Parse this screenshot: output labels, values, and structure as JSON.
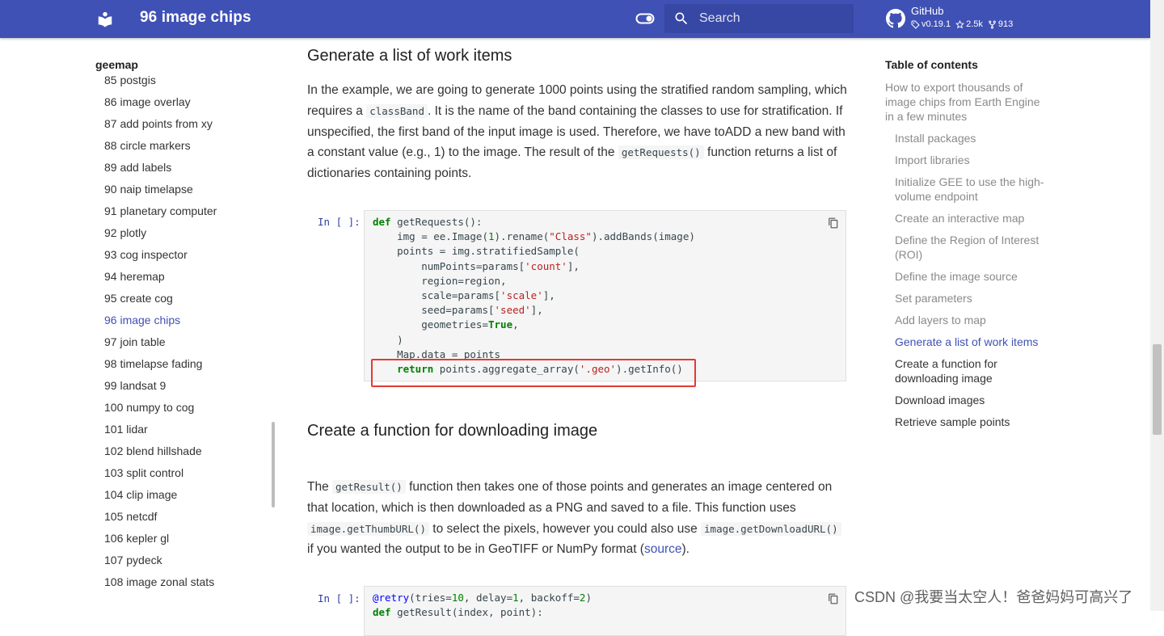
{
  "header": {
    "site_title": "96 image chips",
    "search_placeholder": "Search",
    "repo_name": "GitHub",
    "repo_version": "v0.19.1",
    "repo_stars": "2.5k",
    "repo_forks": "913",
    "colors": {
      "bar": "#4051b5",
      "search_bg": "#3647a4"
    }
  },
  "nav": {
    "title": "geemap",
    "items": [
      "85 postgis",
      "86 image overlay",
      "87 add points from xy",
      "88 circle markers",
      "89 add labels",
      "90 naip timelapse",
      "91 planetary computer",
      "92 plotly",
      "93 cog inspector",
      "94 heremap",
      "95 create cog",
      "96 image chips",
      "97 join table",
      "98 timelapse fading",
      "99 landsat 9",
      "100 numpy to cog",
      "101 lidar",
      "102 blend hillshade",
      "103 split control",
      "104 clip image",
      "105 netcdf",
      "106 kepler gl",
      "107 pydeck",
      "108 image zonal stats"
    ],
    "active_item": "96 image chips"
  },
  "content": {
    "section1_heading": "Generate a list of work items",
    "section1_para": {
      "t1": "In the example, we are going to generate 1000 points using the stratified random sampling, which requires a ",
      "c1": "classBand",
      "t2": ". It is the name of the band containing the classes to use for stratification. If unspecified, the first band of the input image is used. Therefore, we have toADD a new band with a constant value (e.g., 1) to the image. The result of the ",
      "c2": "getRequests()",
      "t3": " function returns a list of dictionaries containing points."
    },
    "cell1_prompt": "In [ ]:",
    "cell1_code": [
      "def getRequests():",
      "    img = ee.Image(1).rename(\"Class\").addBands(image)",
      "    points = img.stratifiedSample(",
      "        numPoints=params['count'],",
      "        region=region,",
      "        scale=params['scale'],",
      "        seed=params['seed'],",
      "        geometries=True,",
      "    )",
      "    Map.data = points",
      "    return points.aggregate_array('.geo').getInfo()"
    ],
    "section2_heading": "Create a function for downloading image",
    "section2_para": {
      "t1": "The ",
      "c1": "getResult()",
      "t2": " function then takes one of those points and generates an image centered on that location, which is then downloaded as a PNG and saved to a file. This function uses ",
      "c2": "image.getThumbURL()",
      "t3": " to select the pixels, however you could also use ",
      "c3": "image.getDownloadURL()",
      "t4": " if you wanted the output to be in GeoTIFF or NumPy format (",
      "link": "source",
      "t5": ")."
    },
    "cell2_prompt": "In [ ]:",
    "cell2_code": [
      "@retry(tries=10, delay=1, backoff=2)",
      "def getResult(index, point):"
    ]
  },
  "toc": {
    "title": "Table of contents",
    "items": [
      {
        "label": "How to export thousands of image chips from Earth Engine in a few minutes",
        "state": "muted"
      },
      {
        "label": "Install packages",
        "state": "muted"
      },
      {
        "label": "Import libraries",
        "state": "muted"
      },
      {
        "label": "Initialize GEE to use the high-volume endpoint",
        "state": "muted"
      },
      {
        "label": "Create an interactive map",
        "state": "muted"
      },
      {
        "label": "Define the Region of Interest (ROI)",
        "state": "muted"
      },
      {
        "label": "Define the image source",
        "state": "muted"
      },
      {
        "label": "Set parameters",
        "state": "muted"
      },
      {
        "label": "Add layers to map",
        "state": "muted"
      },
      {
        "label": "Generate a list of work items",
        "state": "active"
      },
      {
        "label": "Create a function for downloading image",
        "state": "normal"
      },
      {
        "label": "Download images",
        "state": "normal"
      },
      {
        "label": "Retrieve sample points",
        "state": "normal"
      }
    ]
  },
  "watermark": "CSDN @我要当太空人！爸爸妈妈可高兴了"
}
